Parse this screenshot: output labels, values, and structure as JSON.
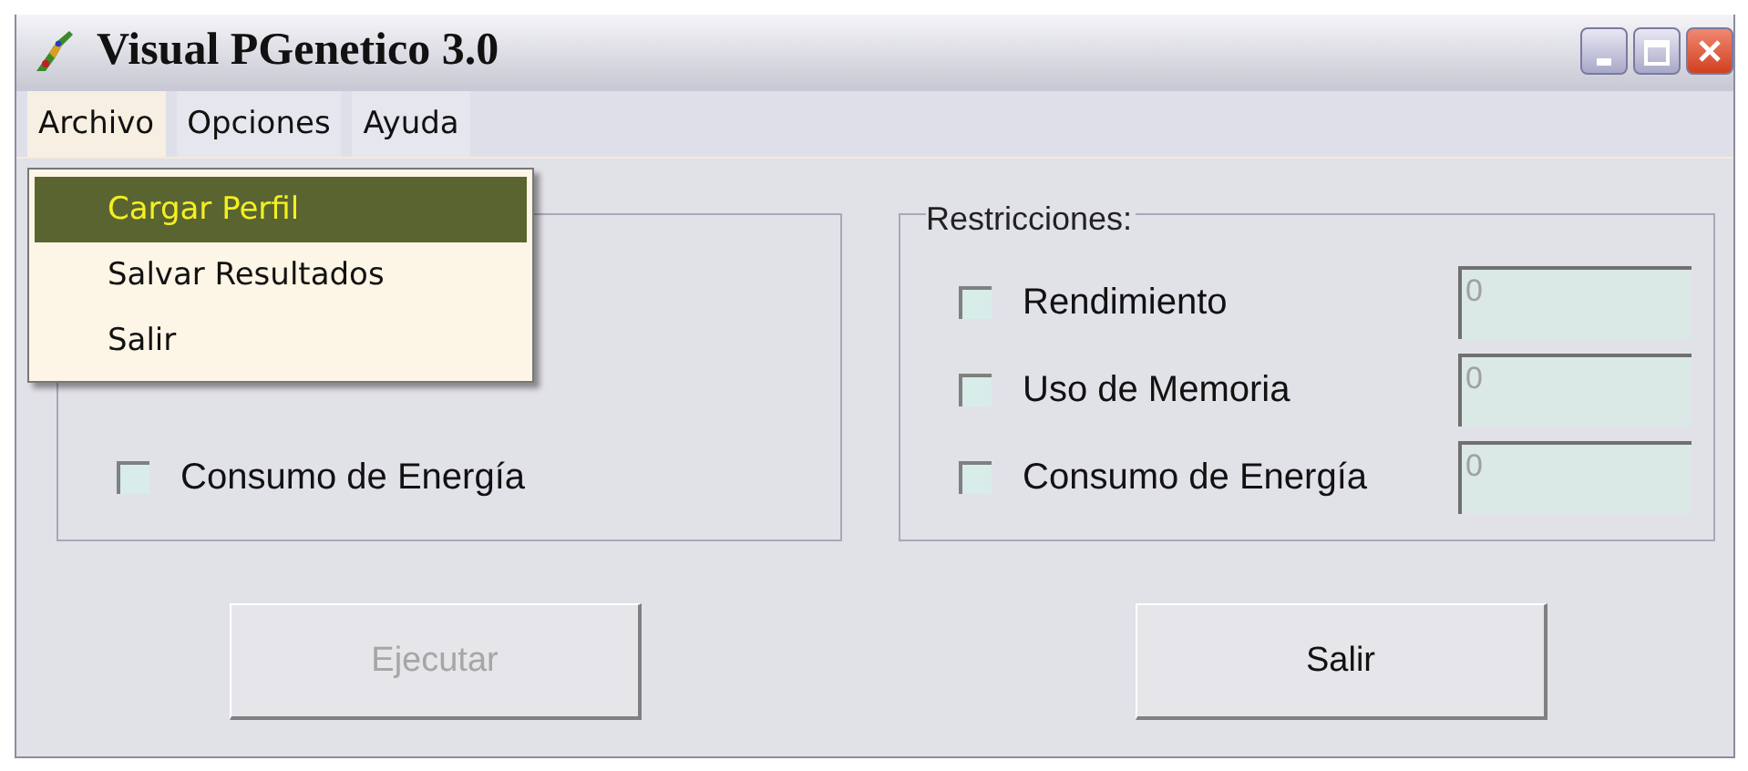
{
  "window": {
    "title": "Visual PGenetico 3.0"
  },
  "menu_bar": [
    {
      "label": "Archivo",
      "selected": true
    },
    {
      "label": "Opciones",
      "selected": false
    },
    {
      "label": "Ayuda",
      "selected": false
    }
  ],
  "open_menu": {
    "items": [
      {
        "label": "Cargar Perfil",
        "selected": true
      },
      {
        "label": "Salvar Resultados",
        "selected": false
      },
      {
        "label": "Salir",
        "selected": false
      }
    ]
  },
  "left_group": {
    "options": [
      {
        "label": "Consumo de Energía",
        "checked": false
      }
    ]
  },
  "restrictions": {
    "title": "Restricciones:",
    "options": [
      {
        "label": "Rendimiento",
        "checked": false,
        "value": "0"
      },
      {
        "label": "Uso de Memoria",
        "checked": false,
        "value": "0"
      },
      {
        "label": "Consumo de Energía",
        "checked": false,
        "value": "0"
      }
    ]
  },
  "buttons": [
    {
      "label": "Ejecutar",
      "disabled": true
    },
    {
      "label": "Salir",
      "disabled": false
    }
  ]
}
